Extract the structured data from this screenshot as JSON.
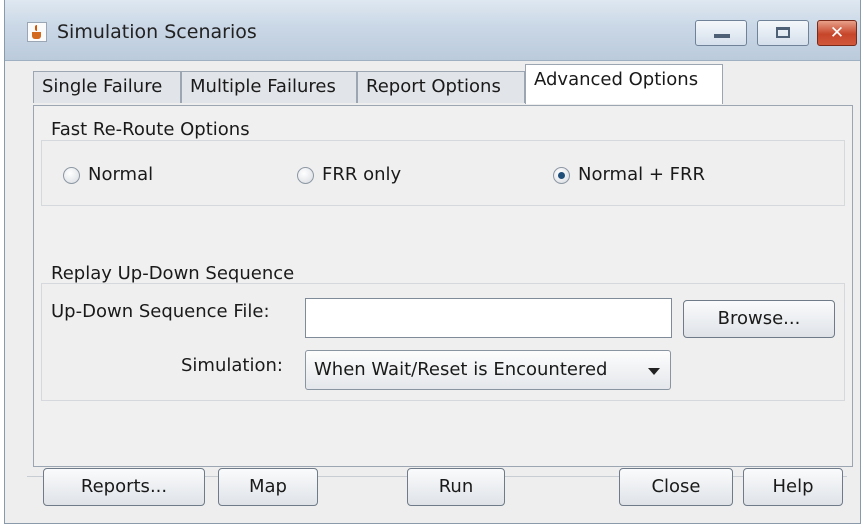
{
  "window": {
    "title": "Simulation Scenarios",
    "controls": {
      "minimize": "minimize",
      "maximize": "maximize",
      "close": "✕"
    }
  },
  "tabs": [
    {
      "label": "Single Failure",
      "active": false
    },
    {
      "label": "Multiple Failures",
      "active": false
    },
    {
      "label": "Report Options",
      "active": false
    },
    {
      "label": "Advanced Options",
      "active": true
    }
  ],
  "frr": {
    "group_title": "Fast Re-Route Options",
    "options": [
      {
        "label": "Normal",
        "selected": false
      },
      {
        "label": "FRR only",
        "selected": false
      },
      {
        "label": "Normal + FRR",
        "selected": true
      }
    ]
  },
  "replay": {
    "group_title": "Replay Up-Down Sequence",
    "file_label": "Up-Down Sequence File:",
    "file_value": "",
    "browse_label": "Browse...",
    "simulation_label": "Simulation:",
    "simulation_value": "When Wait/Reset is Encountered"
  },
  "buttons": {
    "reports": "Reports...",
    "map": "Map",
    "run": "Run",
    "close": "Close",
    "help": "Help"
  },
  "icons": {
    "app": "java-cup-icon",
    "select_arrow": "chevron-down-icon"
  },
  "colors": {
    "titlebar": "#c9d7e6",
    "close_button": "#c6452a",
    "radio_selected": "#1f4e79"
  }
}
